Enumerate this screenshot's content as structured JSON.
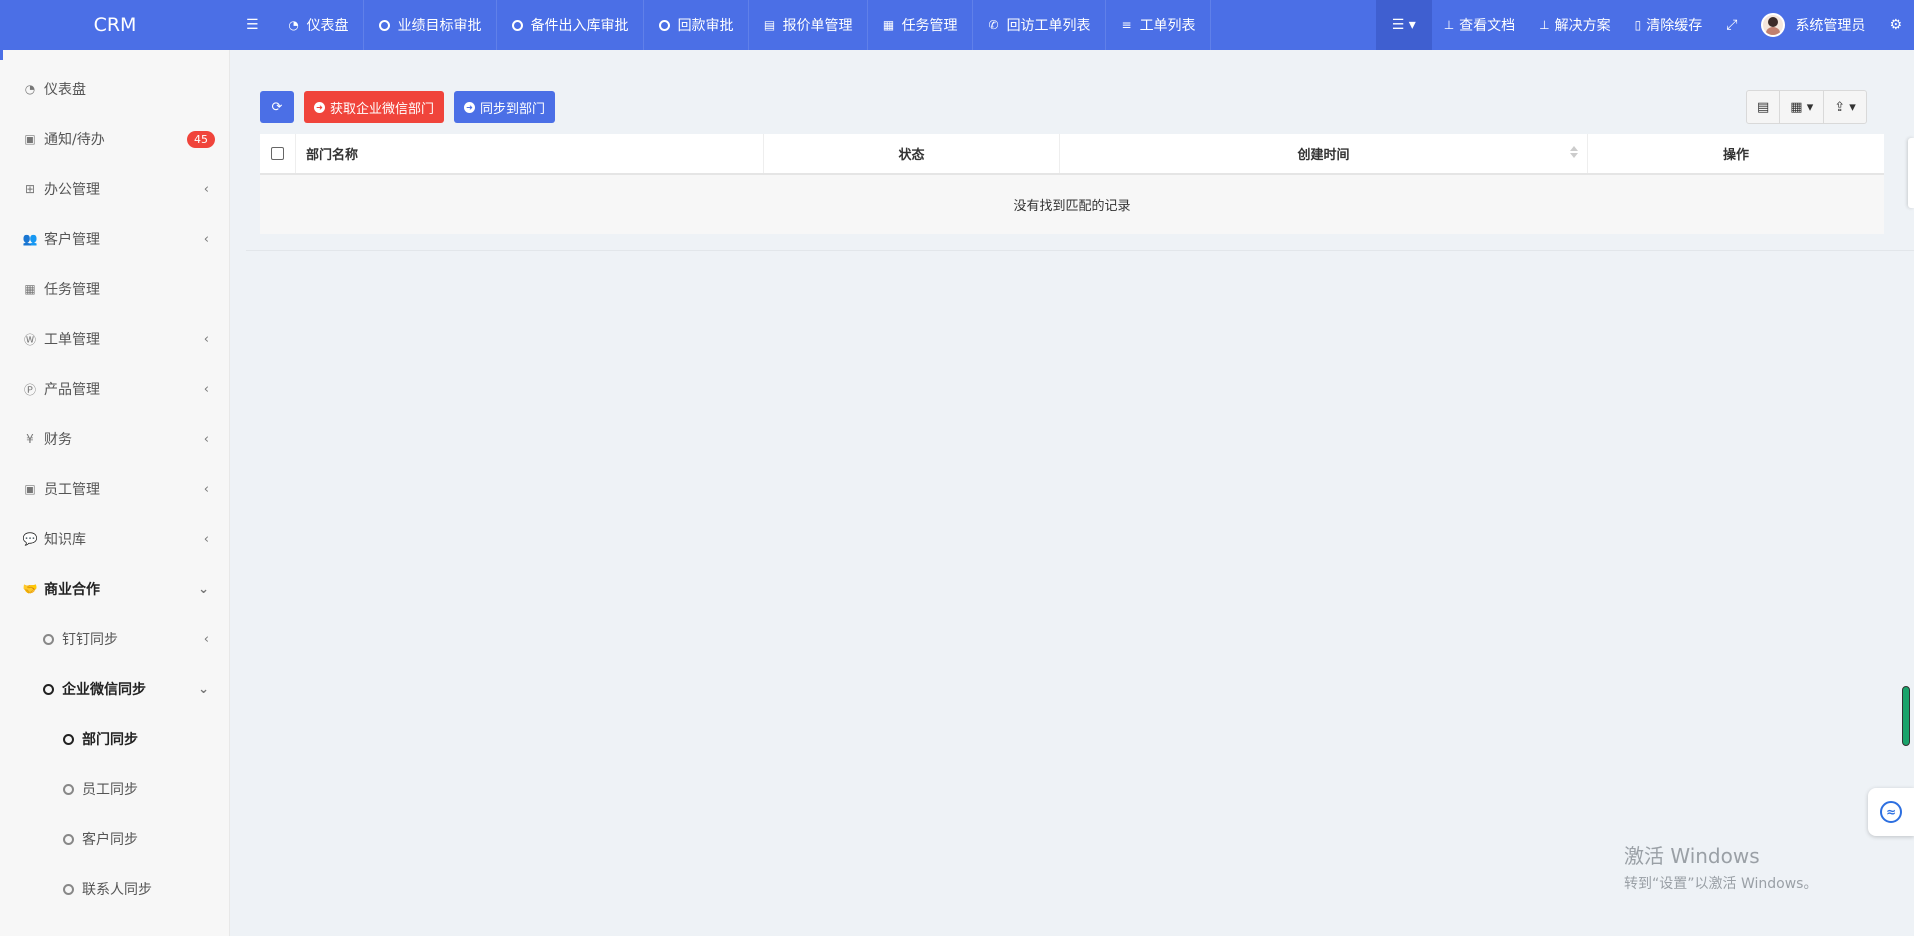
{
  "brand": "CRM",
  "topnav": {
    "items": [
      {
        "label": "仪表盘",
        "icon": "dashboard-icon"
      },
      {
        "label": "业绩目标审批",
        "icon": "circle-icon"
      },
      {
        "label": "备件出入库审批",
        "icon": "circle-icon"
      },
      {
        "label": "回款审批",
        "icon": "circle-icon"
      },
      {
        "label": "报价单管理",
        "icon": "file-icon"
      },
      {
        "label": "任务管理",
        "icon": "calendar-icon"
      },
      {
        "label": "回访工单列表",
        "icon": "phone-icon"
      },
      {
        "label": "工单列表",
        "icon": "list-icon"
      }
    ],
    "right": {
      "docs": "查看文档",
      "solutions": "解决方案",
      "clear_cache": "清除缓存",
      "user": "系统管理员"
    }
  },
  "sidebar": {
    "items": [
      {
        "label": "仪表盘",
        "icon": "dashboard-icon"
      },
      {
        "label": "通知/待办",
        "icon": "calendar-check-icon",
        "badge": "45"
      },
      {
        "label": "办公管理",
        "icon": "windows-icon",
        "caret": "‹"
      },
      {
        "label": "客户管理",
        "icon": "users-icon",
        "caret": "‹"
      },
      {
        "label": "任务管理",
        "icon": "calendar-icon"
      },
      {
        "label": "工单管理",
        "icon": "wordpress-icon",
        "caret": "‹"
      },
      {
        "label": "产品管理",
        "icon": "product-icon",
        "caret": "‹"
      },
      {
        "label": "财务",
        "icon": "yen-icon",
        "caret": "‹"
      },
      {
        "label": "员工管理",
        "icon": "id-card-icon",
        "caret": "‹"
      },
      {
        "label": "知识库",
        "icon": "comments-icon",
        "caret": "‹"
      },
      {
        "label": "商业合作",
        "icon": "handshake-icon",
        "caret": "⌄"
      },
      {
        "label": "钉钉同步",
        "caret": "‹"
      },
      {
        "label": "企业微信同步",
        "caret": "⌄"
      },
      {
        "label": "部门同步"
      },
      {
        "label": "员工同步"
      },
      {
        "label": "客户同步"
      },
      {
        "label": "联系人同步"
      }
    ]
  },
  "toolbar": {
    "fetch_label": "获取企业微信部门",
    "sync_label": "同步到部门"
  },
  "table": {
    "columns": [
      "部门名称",
      "状态",
      "创建时间",
      "操作"
    ],
    "empty_text": "没有找到匹配的记录"
  },
  "watermark": {
    "line1": "激活 Windows",
    "line2": "转到“设置”以激活 Windows。"
  },
  "colors": {
    "primary": "#4b6fe6",
    "danger": "#f0443b",
    "badge": "#f0443b"
  }
}
